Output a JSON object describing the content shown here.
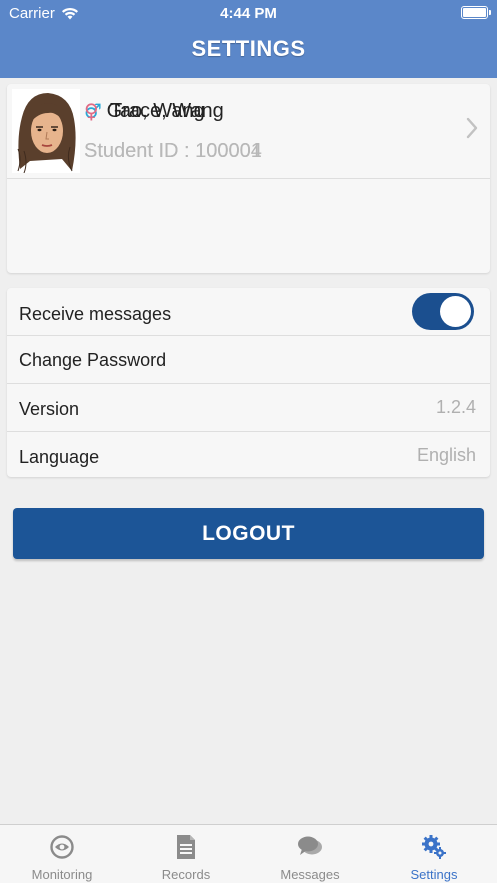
{
  "status_bar": {
    "carrier": "Carrier",
    "time": "4:44 PM"
  },
  "header": {
    "title": "SETTINGS"
  },
  "students": [
    {
      "gender_symbol": "♂",
      "name": "Tao, Wang",
      "student_id": "Student ID : 100001"
    },
    {
      "gender_symbol": "♀",
      "name": "Grace, Wang",
      "student_id": "Student ID : 100004"
    }
  ],
  "settings": {
    "receive_messages": {
      "label": "Receive messages",
      "enabled": true
    },
    "change_password": {
      "label": "Change Password"
    },
    "version": {
      "label": "Version",
      "value": "1.2.4"
    },
    "language": {
      "label": "Language",
      "value": "English"
    }
  },
  "logout_label": "LOGOUT",
  "tabs": [
    {
      "label": "Monitoring",
      "icon": "monitoring-icon"
    },
    {
      "label": "Records",
      "icon": "records-icon"
    },
    {
      "label": "Messages",
      "icon": "messages-icon"
    },
    {
      "label": "Settings",
      "icon": "gear-icon",
      "active": true
    }
  ],
  "colors": {
    "header": "#5b87c9",
    "accent": "#1c5597",
    "male": "#2aa7d6",
    "female": "#e06a85",
    "tab_active": "#3b73c8"
  }
}
